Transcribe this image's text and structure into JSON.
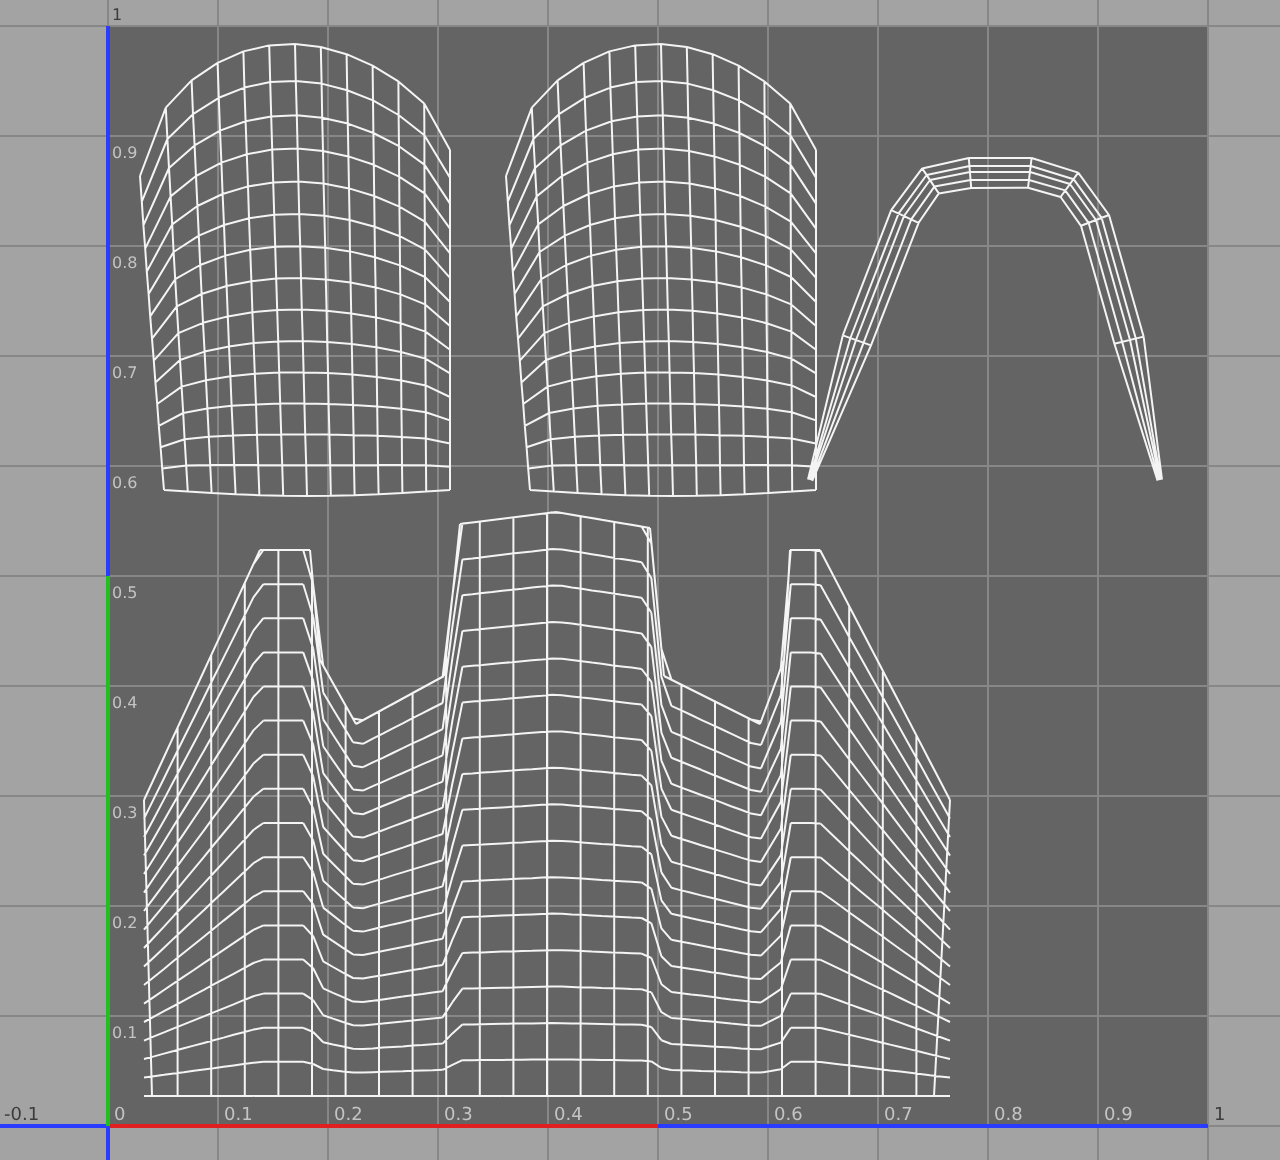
{
  "uv_editor": {
    "u_labels": [
      "-0.1",
      "0",
      "0.1",
      "0.2",
      "0.3",
      "0.4",
      "0.5",
      "0.6",
      "0.7",
      "0.8",
      "0.9",
      "1"
    ],
    "v_labels": [
      "1",
      "0.9",
      "0.8",
      "0.7",
      "0.6",
      "0.5",
      "0.4",
      "0.3",
      "0.2",
      "0.1"
    ]
  }
}
